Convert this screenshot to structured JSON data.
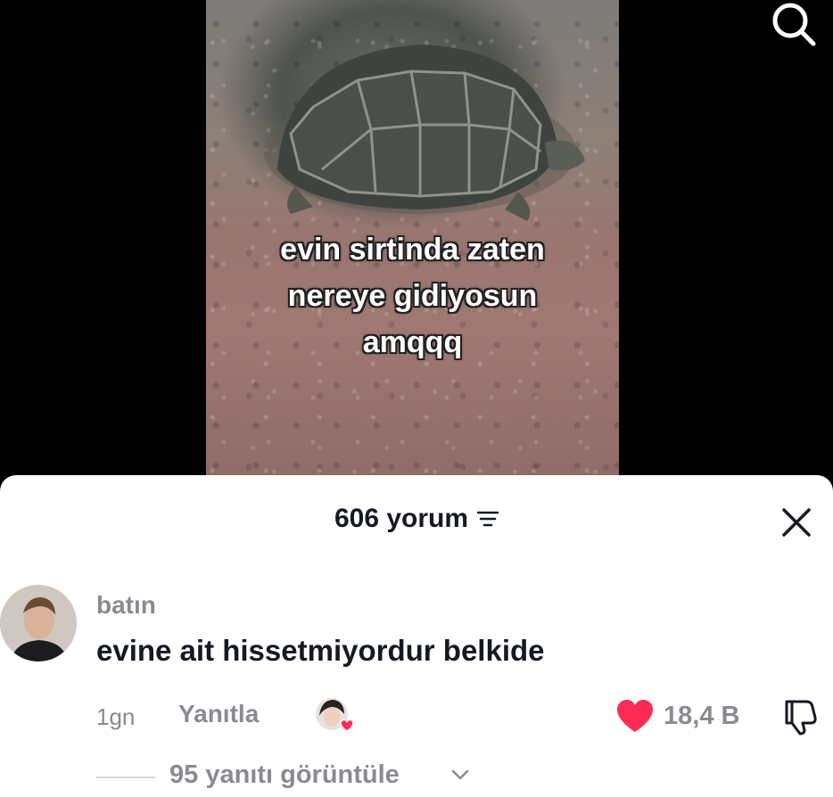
{
  "video": {
    "caption_lines": [
      "evin sirtinda zaten",
      "nereye gidiyosun",
      "amqqq"
    ]
  },
  "comments_panel": {
    "count_label": "606 yorum"
  },
  "comment": {
    "username": "batın",
    "text": "evine ait hissetmiyordur belkide",
    "time": "1gn",
    "reply_label": "Yanıtla",
    "like_count": "18,4 B",
    "view_replies_label": "95 yanıtı görüntüle"
  },
  "colors": {
    "like_heart": "#fe2c55",
    "muted_text": "#8a8b91",
    "primary_text": "#161823"
  },
  "icons": [
    "search-icon",
    "sort-icon",
    "close-icon",
    "heart-icon",
    "dislike-icon",
    "chevron-down-icon"
  ]
}
